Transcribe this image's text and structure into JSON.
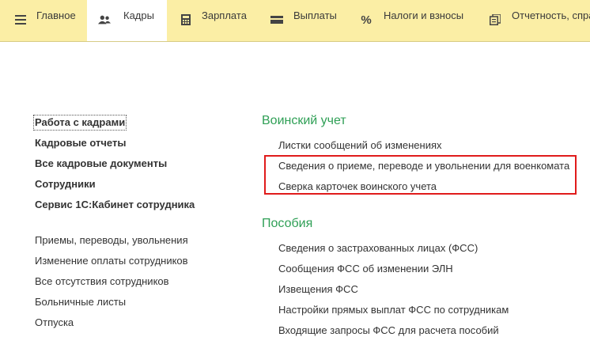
{
  "tabs": [
    {
      "label": "Главное",
      "icon": "menu-icon"
    },
    {
      "label": "Кадры",
      "icon": "people-icon",
      "active": true
    },
    {
      "label": "Зарплата",
      "icon": "calculator-icon"
    },
    {
      "label": "Выплаты",
      "icon": "wallet-icon"
    },
    {
      "label": "Налоги и взносы",
      "icon": "percent-icon"
    },
    {
      "label": "Отчетность, спра",
      "icon": "reports-icon"
    }
  ],
  "left_bold": [
    "Работа с кадрами",
    "Кадровые отчеты",
    "Все кадровые документы",
    "Сотрудники",
    "Сервис 1С:Кабинет сотрудника"
  ],
  "left_regular": [
    "Приемы, переводы, увольнения",
    "Изменение оплаты сотрудников",
    "Все отсутствия сотрудников",
    "Больничные листы",
    "Отпуска"
  ],
  "groups": [
    {
      "title": "Воинский учет",
      "items": [
        "Листки сообщений об изменениях",
        "Сведения о приеме, переводе и увольнении для военкомата",
        "Сверка карточек воинского учета"
      ]
    },
    {
      "title": "Пособия",
      "items": [
        "Сведения о застрахованных лицах (ФСС)",
        "Сообщения ФСС об изменении ЭЛН",
        "Извещения ФСС",
        "Настройки прямых выплат ФСС по сотрудникам",
        "Входящие запросы ФСС для расчета пособий"
      ]
    }
  ],
  "colors": {
    "topbar": "#fbeea5",
    "group_title": "#2e9f55",
    "highlight": "#e01b1b"
  }
}
